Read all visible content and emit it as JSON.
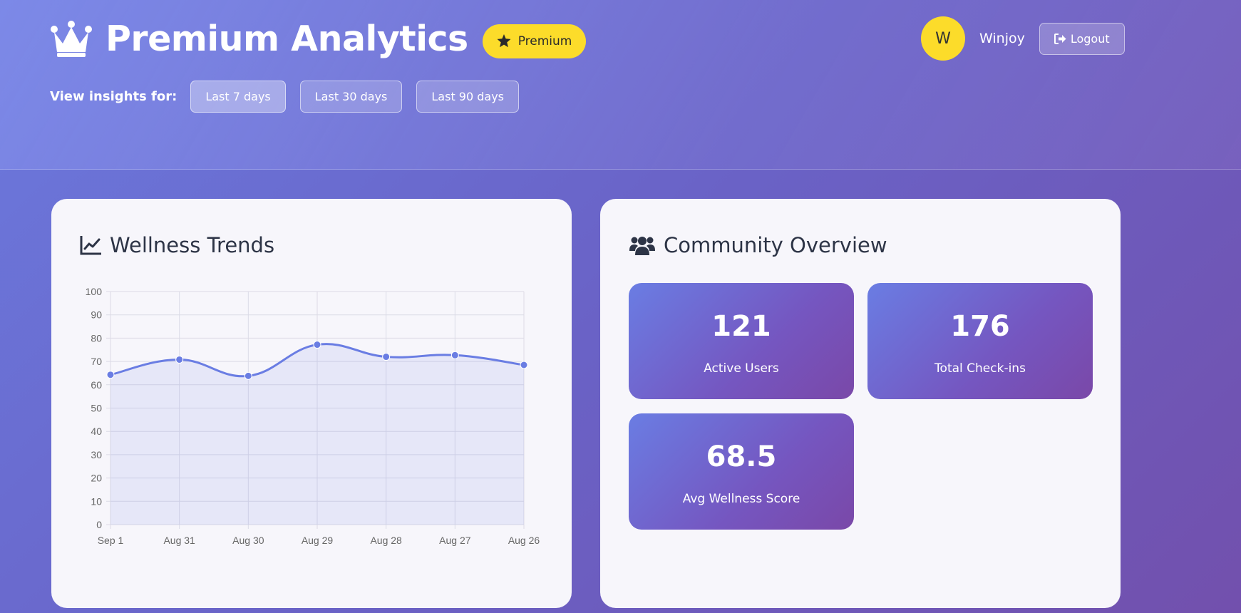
{
  "header": {
    "title": "Premium Analytics",
    "badge_label": "Premium",
    "range_label": "View insights for:",
    "ranges": [
      {
        "label": "Last 7 days",
        "active": true
      },
      {
        "label": "Last 30 days",
        "active": false
      },
      {
        "label": "Last 90 days",
        "active": false
      }
    ],
    "user": {
      "initial": "W",
      "name": "Winjoy"
    },
    "logout_label": "Logout"
  },
  "wellness": {
    "title": "Wellness Trends"
  },
  "community": {
    "title": "Community Overview",
    "stats": [
      {
        "value": "121",
        "label": "Active Users"
      },
      {
        "value": "176",
        "label": "Total Check-ins"
      },
      {
        "value": "68.5",
        "label": "Avg Wellness Score"
      }
    ]
  },
  "colors": {
    "accent": "#fcdc2a",
    "line": "#6a7de3"
  },
  "chart_data": {
    "type": "line",
    "x": [
      "Sep 1",
      "Aug 31",
      "Aug 30",
      "Aug 29",
      "Aug 28",
      "Aug 27",
      "Aug 26"
    ],
    "series": [
      {
        "values": [
          64.3,
          70.8,
          63.8,
          77.2,
          72.0,
          72.7,
          68.5
        ]
      }
    ],
    "yticks": [
      0,
      10,
      20,
      30,
      40,
      50,
      60,
      70,
      80,
      90,
      100
    ],
    "ylim": [
      0,
      100
    ],
    "grid": true,
    "area_fill": true
  }
}
